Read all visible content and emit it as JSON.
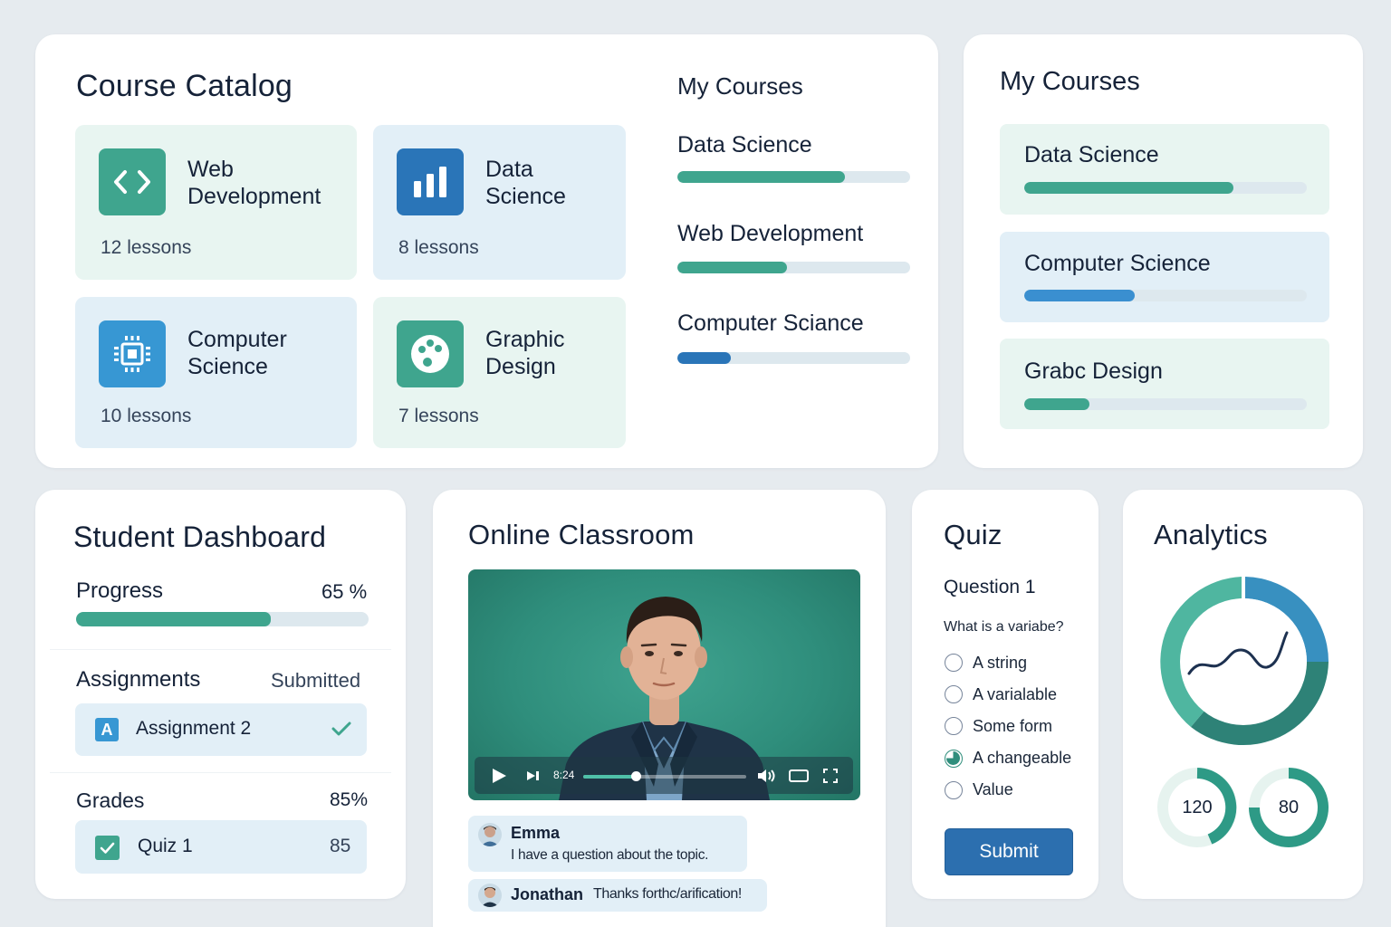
{
  "catalog": {
    "title": "Course Catalog",
    "tiles": [
      {
        "title": "Web Development",
        "lessons": "12 lessons",
        "icon": "code-icon",
        "color": "#3fa58e"
      },
      {
        "title": "Data Science",
        "lessons": "8 lessons",
        "icon": "bar-chart-icon",
        "color": "#2a75b8"
      },
      {
        "title": "Computer Science",
        "lessons": "10 lessons",
        "icon": "chip-icon",
        "color": "#3797d3"
      },
      {
        "title": "Graphic Design",
        "lessons": "7 lessons",
        "icon": "palette-icon",
        "color": "#3fa58e"
      }
    ],
    "my_courses": {
      "title": "My Courses",
      "items": [
        {
          "label": "Data Science",
          "progress": 0.72,
          "color": "#3fa58e"
        },
        {
          "label": "Web Development",
          "progress": 0.47,
          "color": "#3fa58e"
        },
        {
          "label": "Computer Sciance",
          "progress": 0.23,
          "color": "#2a75b8"
        }
      ]
    }
  },
  "my_courses_panel": {
    "title": "My Courses",
    "items": [
      {
        "label": "Data Science",
        "progress": 0.74,
        "color": "#3fa58e"
      },
      {
        "label": "Computer Science",
        "progress": 0.39,
        "color": "#3a8fd0"
      },
      {
        "label": "Grabc Design",
        "progress": 0.23,
        "color": "#3fa58e"
      }
    ]
  },
  "dashboard": {
    "title": "Student Dashboard",
    "progress_label": "Progress",
    "progress_value": "65 %",
    "progress_fraction": 0.665,
    "assignments_label": "Assignments",
    "assignments_status": "Submitted",
    "assignment_name": "Assignment 2",
    "assignment_badge": "A",
    "grades_label": "Grades",
    "grades_value": "85%",
    "quiz_name": "Quiz 1",
    "quiz_score": "85"
  },
  "classroom": {
    "title": "Online Classroom",
    "video_time": "8:24",
    "video_progress": 0.32,
    "chat": [
      {
        "name": "Emma",
        "message": "I have a question about the topic."
      },
      {
        "name": "Jonathan",
        "message": "Thanks forthc/arification!"
      }
    ]
  },
  "quiz": {
    "title": "Quiz",
    "question_label": "Question 1",
    "question_text": "What is a variabe?",
    "options": [
      {
        "label": "A string",
        "selected": false
      },
      {
        "label": "A varialable",
        "selected": false
      },
      {
        "label": "Some form",
        "selected": false
      },
      {
        "label": "A changeable",
        "selected": true
      },
      {
        "label": "Value",
        "selected": false
      }
    ],
    "submit_label": "Submit"
  },
  "analytics": {
    "title": "Analytics",
    "stat_1": "120",
    "stat_2": "80"
  }
}
